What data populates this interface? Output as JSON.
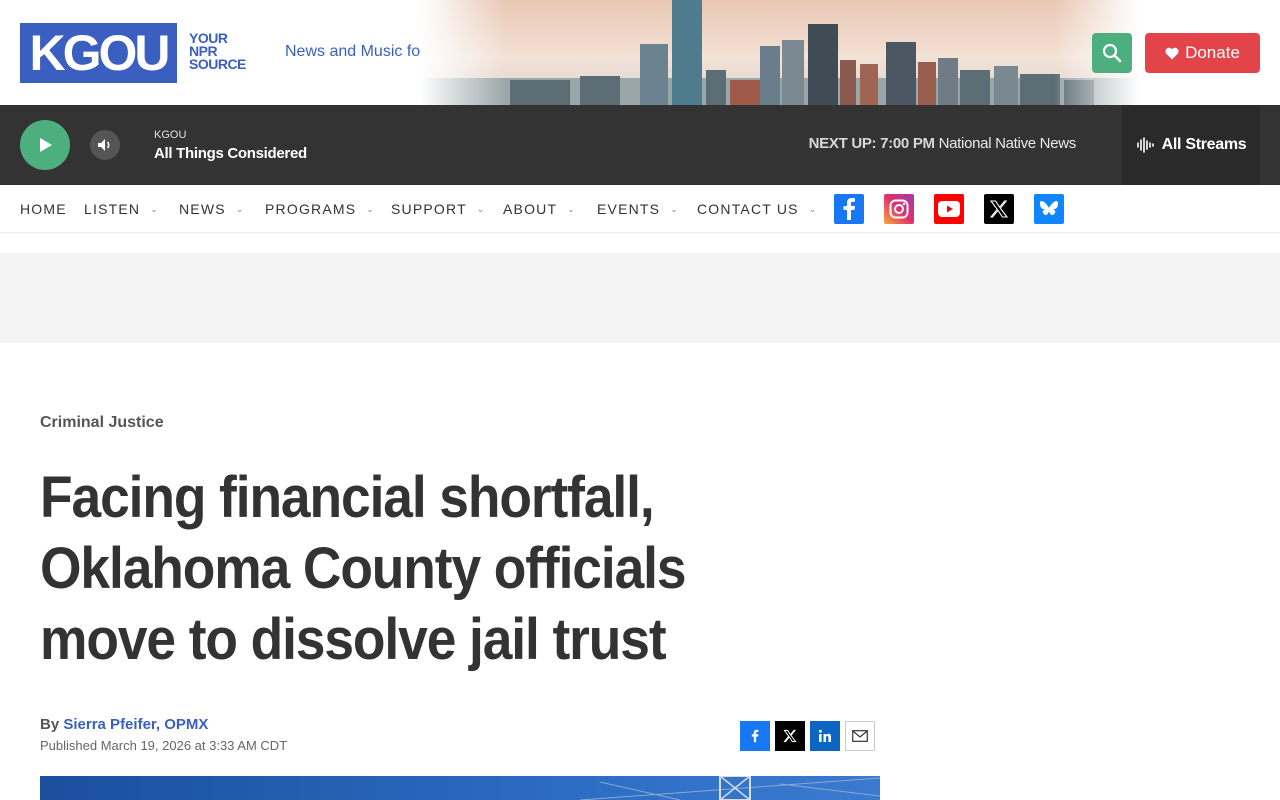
{
  "header": {
    "logo_text": "KGOU",
    "logo_tag": [
      "YOUR",
      "NPR",
      "SOURCE"
    ],
    "tagline": "News and Music for Oklahoma",
    "donate_label": "Donate",
    "brand_color": "#3b5fc0",
    "search_color": "#4caf7d",
    "donate_color": "#e3444a"
  },
  "player": {
    "station": "KGOU",
    "show": "All Things Considered",
    "next_up_label": "NEXT UP:",
    "next_up_time": "7:00 PM",
    "next_up_show": "National Native News",
    "streams_label": "All Streams"
  },
  "nav": {
    "items": [
      {
        "label": "HOME",
        "dropdown": false
      },
      {
        "label": "LISTEN",
        "dropdown": true
      },
      {
        "label": "NEWS",
        "dropdown": true
      },
      {
        "label": "PROGRAMS",
        "dropdown": true
      },
      {
        "label": "SUPPORT",
        "dropdown": true
      },
      {
        "label": "ABOUT",
        "dropdown": true
      },
      {
        "label": "EVENTS",
        "dropdown": true
      },
      {
        "label": "CONTACT US",
        "dropdown": true
      }
    ],
    "social": [
      "facebook-icon",
      "instagram-icon",
      "youtube-icon",
      "x-icon",
      "bluesky-icon"
    ]
  },
  "article": {
    "kicker": "Criminal Justice",
    "headline": "Facing financial shortfall, Oklahoma County officials move to dissolve jail trust",
    "by": "By",
    "authors": "Sierra Pfeifer, OPMX",
    "published": "Published March 19, 2026 at 3:33 AM CDT",
    "share": [
      "facebook-icon",
      "x-icon",
      "linkedin-icon",
      "email-icon"
    ]
  }
}
